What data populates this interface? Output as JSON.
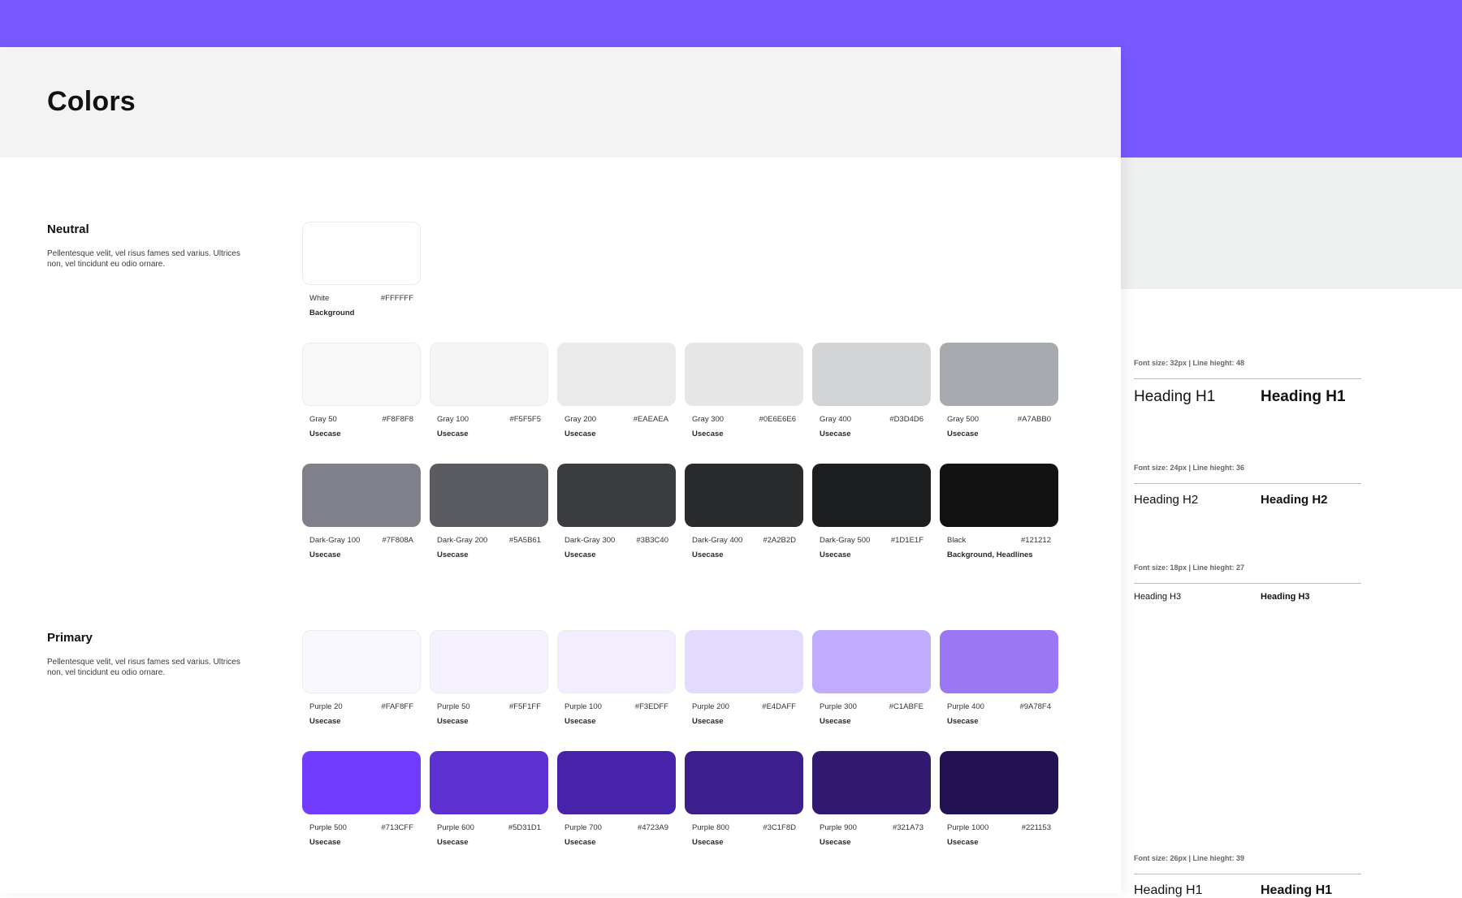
{
  "page": {
    "title": "Colors"
  },
  "neutral": {
    "title": "Neutral",
    "description": "Pellentesque velit, vel risus fames sed varius. Ultrices non, vel tincidunt eu odio ornare.",
    "white": {
      "name": "White",
      "hex": "#FFFFFF",
      "usecase": "Background",
      "color": "#FFFFFF"
    },
    "grays": [
      {
        "name": "Gray 50",
        "hex": "#F8F8F8",
        "usecase": "Usecase",
        "color": "#F8F8F8"
      },
      {
        "name": "Gray 100",
        "hex": "#F5F5F5",
        "usecase": "Usecase",
        "color": "#F5F5F5"
      },
      {
        "name": "Gray 200",
        "hex": "#EAEAEA",
        "usecase": "Usecase",
        "color": "#EAEAEA"
      },
      {
        "name": "Gray 300",
        "hex": "#0E6E6E6",
        "usecase": "Usecase",
        "color": "#E6E6E6"
      },
      {
        "name": "Gray 400",
        "hex": "#D3D4D6",
        "usecase": "Usecase",
        "color": "#D3D4D6"
      },
      {
        "name": "Gray 500",
        "hex": "#A7ABB0",
        "usecase": "Usecase",
        "color": "#A7ABB0"
      }
    ],
    "dark_grays": [
      {
        "name": "Dark-Gray 100",
        "hex": "#7F808A",
        "usecase": "Usecase",
        "color": "#7F808A"
      },
      {
        "name": "Dark-Gray 200",
        "hex": "#5A5B61",
        "usecase": "Usecase",
        "color": "#5A5B61"
      },
      {
        "name": "Dark-Gray 300",
        "hex": "#3B3C40",
        "usecase": "Usecase",
        "color": "#3B3C40"
      },
      {
        "name": "Dark-Gray 400",
        "hex": "#2A2B2D",
        "usecase": "Usecase",
        "color": "#2A2B2D"
      },
      {
        "name": "Dark-Gray 500",
        "hex": "#1D1E1F",
        "usecase": "Usecase",
        "color": "#1D1E1F"
      },
      {
        "name": "Black",
        "hex": "#121212",
        "usecase": "Background, Headlines",
        "color": "#121212"
      }
    ]
  },
  "primary": {
    "title": "Primary",
    "description": "Pellentesque velit, vel risus fames sed varius. Ultrices non, vel tincidunt eu odio ornare.",
    "light": [
      {
        "name": "Purple 20",
        "hex": "#FAF8FF",
        "usecase": "Usecase",
        "color": "#FAF8FF"
      },
      {
        "name": "Purple 50",
        "hex": "#F5F1FF",
        "usecase": "Usecase",
        "color": "#F5F1FF"
      },
      {
        "name": "Purple 100",
        "hex": "#F3EDFF",
        "usecase": "Usecase",
        "color": "#F3EDFF"
      },
      {
        "name": "Purple 200",
        "hex": "#E4DAFF",
        "usecase": "Usecase",
        "color": "#E4DAFF"
      },
      {
        "name": "Purple 300",
        "hex": "#C1ABFE",
        "usecase": "Usecase",
        "color": "#C1ABFE"
      },
      {
        "name": "Purple 400",
        "hex": "#9A78F4",
        "usecase": "Usecase",
        "color": "#9A78F4"
      }
    ],
    "dark": [
      {
        "name": "Purple 500",
        "hex": "#713CFF",
        "usecase": "Usecase",
        "color": "#713CFF"
      },
      {
        "name": "Purple 600",
        "hex": "#5D31D1",
        "usecase": "Usecase",
        "color": "#5D31D1"
      },
      {
        "name": "Purple 700",
        "hex": "#4723A9",
        "usecase": "Usecase",
        "color": "#4723A9"
      },
      {
        "name": "Purple 800",
        "hex": "#3C1F8D",
        "usecase": "Usecase",
        "color": "#3C1F8D"
      },
      {
        "name": "Purple 900",
        "hex": "#321A73",
        "usecase": "Usecase",
        "color": "#321A73"
      },
      {
        "name": "Purple 1000",
        "hex": "#221153",
        "usecase": "Usecase",
        "color": "#221153"
      }
    ]
  },
  "typography": [
    {
      "spec": "Font size: 32px  |  Line hieght: 48",
      "light": "Heading H1",
      "bold": "Heading H1"
    },
    {
      "spec": "Font size: 24px  |  Line hieght: 36",
      "light": "Heading H2",
      "bold": "Heading H2"
    },
    {
      "spec": "Font size: 18px  |  Line hieght: 27",
      "light": "Heading H3",
      "bold": "Heading H3"
    },
    {
      "spec": "Font size: 26px  |  Line hieght: 39",
      "light": "Heading H1",
      "bold": "Heading H1"
    }
  ],
  "colors": {
    "accent": "#7859FF",
    "header_bg": "#F2F3F2"
  }
}
